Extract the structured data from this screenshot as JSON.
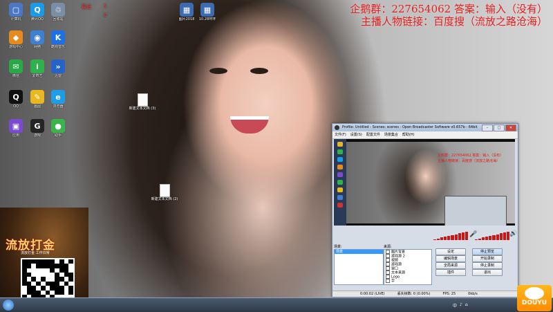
{
  "overlay": {
    "line1": "企鹅群：227654062 答案：输入（没有）",
    "line2": "主播人物链接：百度搜（流放之路沧海）",
    "topleft_a": "本号",
    "topleft_b": "最低",
    "topleft_c": "0",
    "topleft_d": "5",
    "topleft_e": "0"
  },
  "desktop": {
    "icons": [
      {
        "label": "计算机",
        "glyph": "▢",
        "color": "#4c77c4"
      },
      {
        "label": "腾讯QQ",
        "glyph": "Q",
        "color": "#1b9be6"
      },
      {
        "label": "回收站",
        "glyph": "♲",
        "color": "#7a8fa5"
      },
      {
        "label": "游戏中心",
        "glyph": "◆",
        "color": "#e58a1f"
      },
      {
        "label": "网络",
        "glyph": "◉",
        "color": "#3e7fd1"
      },
      {
        "label": "酷狗音乐",
        "glyph": "K",
        "color": "#1d6fe6"
      },
      {
        "label": "微信",
        "glyph": "✉",
        "color": "#2aa845"
      },
      {
        "label": "爱奇艺",
        "glyph": "i",
        "color": "#2fb24b"
      },
      {
        "label": "迅雷",
        "glyph": "»",
        "color": "#2563c8"
      },
      {
        "label": "QQ",
        "glyph": "Q",
        "color": "#111111"
      },
      {
        "label": "画图",
        "glyph": "✎",
        "color": "#e8b820"
      },
      {
        "label": "浏览器",
        "glyph": "e",
        "color": "#1f9ee8"
      },
      {
        "label": "应用",
        "glyph": "▣",
        "color": "#7a4bd1"
      },
      {
        "label": "游戏",
        "glyph": "G",
        "color": "#242424"
      },
      {
        "label": "助手",
        "glyph": "●",
        "color": "#39b54a"
      }
    ],
    "top_icons": [
      {
        "label": "图片2018"
      },
      {
        "label": "10.28环环"
      }
    ],
    "files": [
      {
        "label": "新建文本文档 (3)"
      },
      {
        "label": "新建文本文档 (2)"
      }
    ]
  },
  "promo": {
    "title": "流放打金",
    "subtitle": "流放打金 工作日常"
  },
  "obs": {
    "title": "Profile: Untitled - Scenes: scenes - Open Broadcaster Software v0.657b - 64bit",
    "menu": [
      "文件(F)",
      "设置(S)",
      "配置文件",
      "场景集合",
      "帮助(H)"
    ],
    "preview_text": "企鹅群：227654062 答案：输入（没有）",
    "preview_text2": "主播人物链接：百度搜（流放之路沧海）",
    "scenes_label": "场景:",
    "sources_label": "来源:",
    "scenes": [
      "场景"
    ],
    "sources": [
      "图片背景",
      "游戏源 2",
      "视频",
      "游戏源",
      "窗口",
      "文本来源",
      "Logo",
      "字"
    ],
    "buttons": {
      "settings": "设定",
      "stop_preview": "停止预览",
      "edit_scene": "编辑场景",
      "start_record": "开始录制",
      "global_sources": "全局来源",
      "stop_rec": "停止录制",
      "plugins": "插件",
      "exit": "退出"
    },
    "status": {
      "time": "0:00:02 (LIVE)",
      "dropped": "丢失帧数: 0 (0.00%)",
      "fps": "FPS: 25",
      "bitrate": "0kb/s"
    }
  },
  "taskbar": {
    "tray": [
      "中",
      "♪",
      "⌂"
    ],
    "brand": "DOUYU"
  }
}
